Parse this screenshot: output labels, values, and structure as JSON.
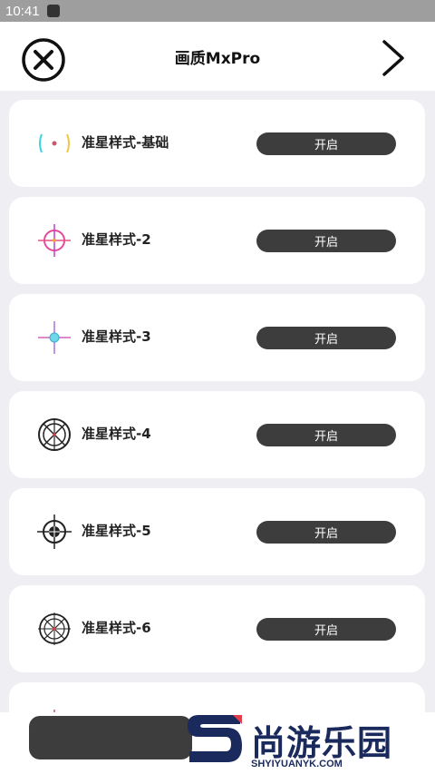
{
  "status_bar": {
    "time": "10:41"
  },
  "header": {
    "title": "画质MxPro"
  },
  "items": [
    {
      "label": "准星样式-基础",
      "button": "开启",
      "icon": "crosshair-basic-icon"
    },
    {
      "label": "准星样式-2",
      "button": "开启",
      "icon": "crosshair-2-icon"
    },
    {
      "label": "准星样式-3",
      "button": "开启",
      "icon": "crosshair-3-icon"
    },
    {
      "label": "准星样式-4",
      "button": "开启",
      "icon": "crosshair-4-icon"
    },
    {
      "label": "准星样式-5",
      "button": "开启",
      "icon": "crosshair-5-icon"
    },
    {
      "label": "准星样式-6",
      "button": "开启",
      "icon": "crosshair-6-icon"
    }
  ],
  "watermark": {
    "name": "尚游乐园",
    "domain": "SHYIYUANYK.COM"
  },
  "colors": {
    "button": "#3d3d3d",
    "background": "#eeeef3",
    "watermark": "#1a2a5c",
    "accent": "#e23d4b"
  }
}
